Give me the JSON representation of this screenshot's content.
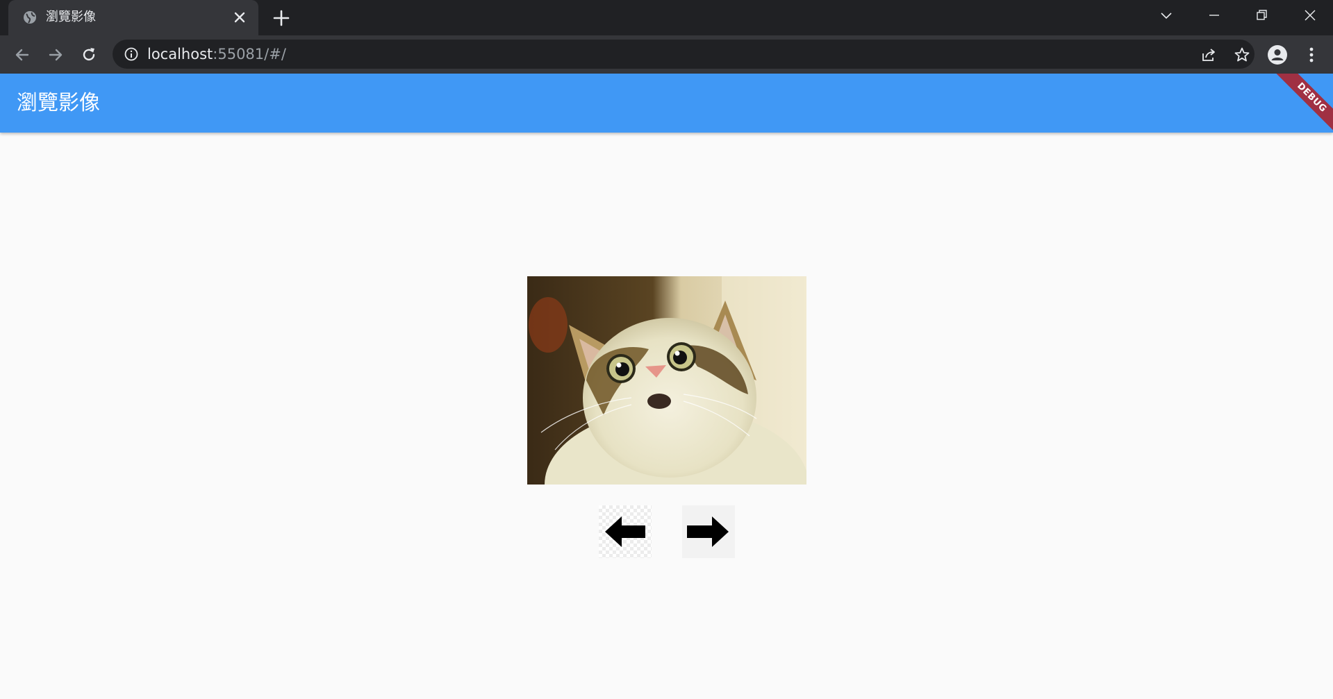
{
  "browser": {
    "tab_title": "瀏覽影像",
    "url_host": "localhost",
    "url_path": ":55081/#/"
  },
  "app": {
    "title": "瀏覽影像",
    "debug_banner": "DEBUG",
    "accent_color": "#4098f5"
  },
  "viewer": {
    "image_subject": "surprised cat photo",
    "prev_icon": "arrow-left-icon",
    "next_icon": "arrow-right-icon"
  }
}
